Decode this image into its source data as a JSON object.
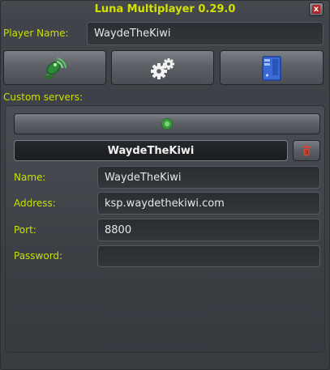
{
  "window": {
    "title": "Luna Multiplayer 0.29.0",
    "close_glyph": "x"
  },
  "player": {
    "label": "Player Name:",
    "value": "WaydeTheKiwi"
  },
  "toolbar": {
    "connect_icon": "satellite-dish-icon",
    "settings_icon": "gears-icon",
    "server_icon": "server-tower-icon"
  },
  "custom_servers": {
    "label": "Custom servers:",
    "add_icon": "add-server-icon",
    "selected_server": "WaydeTheKiwi",
    "delete_icon": "trash-icon",
    "fields": {
      "name_label": "Name:",
      "name_value": "WaydeTheKiwi",
      "address_label": "Address:",
      "address_value": "ksp.waydethekiwi.com",
      "port_label": "Port:",
      "port_value": "8800",
      "password_label": "Password:",
      "password_value": ""
    }
  },
  "colors": {
    "accent_text": "#c8e000",
    "title_text": "#d4e100",
    "background": "#3d4146",
    "close_red": "#b32525"
  }
}
